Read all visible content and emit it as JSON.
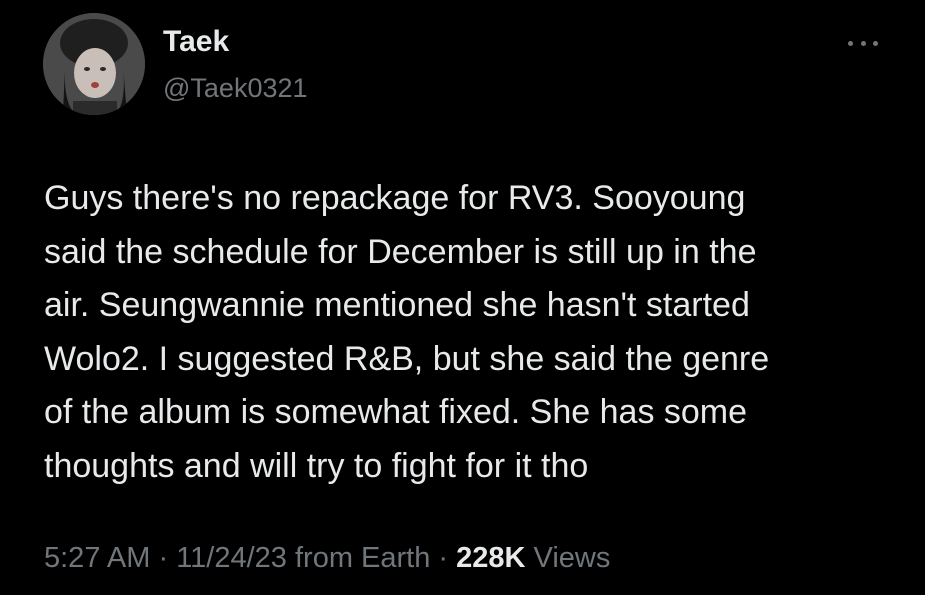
{
  "author": {
    "display_name": "Taek",
    "handle": "@Taek0321",
    "avatar_icon": "profile-photo"
  },
  "more_icon": "more-horizontal-icon",
  "tweet": {
    "text": "Guys there's no repackage for RV3. Sooyoung\nsaid the schedule for December is still up in the\nair. Seungwannie mentioned she hasn't started\nWolo2. I suggested R&B, but she said the genre\nof the album is somewhat fixed. She has some\nthoughts and will try to fight for it tho"
  },
  "meta": {
    "time": "5:27 AM",
    "separator": " · ",
    "date": "11/24/23",
    "source": "from Earth",
    "views_count": "228K",
    "views_label": "Views"
  },
  "colors": {
    "background": "#000000",
    "primary_text": "#e7e9ea",
    "secondary_text": "#71767b"
  }
}
